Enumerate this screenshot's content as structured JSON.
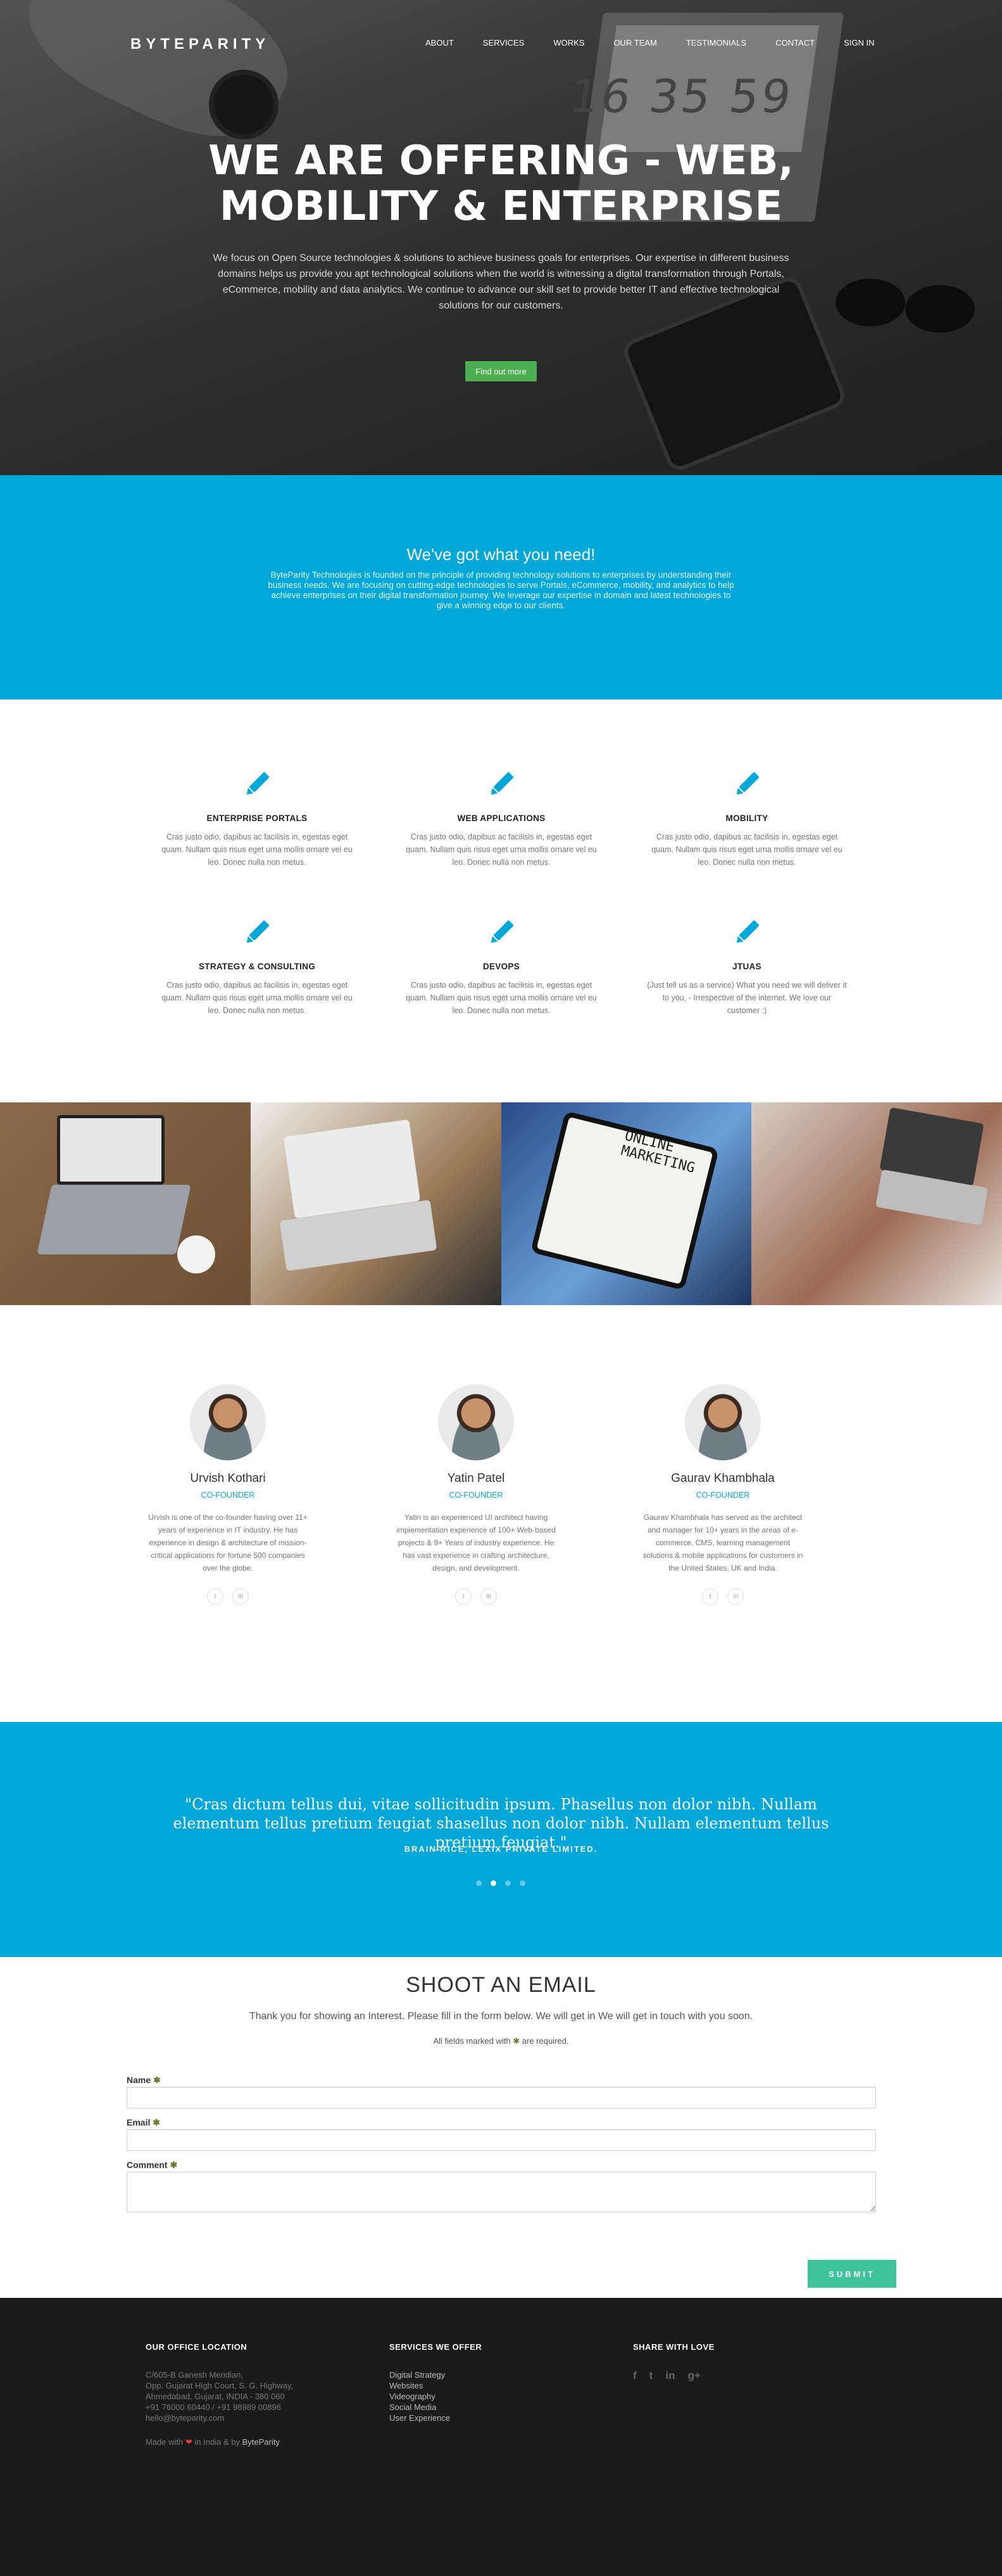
{
  "nav": {
    "logo": "BYTEPARITY",
    "links": [
      "ABOUT",
      "SERVICES",
      "WORKS",
      "OUR TEAM",
      "TESTIMONIALS",
      "CONTACT",
      "SIGN IN"
    ]
  },
  "hero": {
    "clock": "16 35 59",
    "title_line1": "WE ARE OFFERING - WEB,",
    "title_line2": "MOBILITY & ENTERPRISE",
    "text": "We focus on Open Source technologies & solutions to achieve business goals for enterprises. Our expertise in different business domains helps us provide you apt technological solutions when the world is witnessing a digital transformation through Portals, eCommerce, mobility and data analytics. We continue to advance our skill set to provide better IT and effective technological solutions for our customers.",
    "button": "Find out more"
  },
  "about": {
    "title": "We've got what you need!",
    "text": "ByteParity Technologies is founded on the principle of providing technology solutions to enterprises by understanding their business needs. We are focusing on cutting-edge technologies to serve Portals, eCommerce, mobility, and analytics to help achieve enterprises on their digital transformation journey. We leverage our expertise in domain and latest technologies to give a winning edge to our clients."
  },
  "services": [
    {
      "title": "ENTERPRISE PORTALS",
      "text": "Cras justo odio, dapibus ac facilisis in, egestas eget quam. Nullam quis risus eget urna mollis ornare vel eu leo. Donec nulla non metus.",
      "icon": "pencil-icon"
    },
    {
      "title": "WEB APPLICATIONS",
      "text": "Cras justo odio, dapibus ac facilisis in, egestas eget quam. Nullam quis risus eget urna mollis ornare vel eu leo. Donec nulla non metus.",
      "icon": "pencil-icon"
    },
    {
      "title": "MOBILITY",
      "text": "Cras justo odio, dapibus ac facilisis in, egestas eget quam. Nullam quis risus eget urna mollis ornare vel eu leo. Donec nulla non metus.",
      "icon": "pencil-icon"
    },
    {
      "title": "STRATEGY & CONSULTING",
      "text": "Cras justo odio, dapibus ac facilisis in, egestas eget quam. Nullam quis risus eget urna mollis ornare vel eu leo. Donec nulla non metus.",
      "icon": "pencil-icon"
    },
    {
      "title": "DEVOPS",
      "text": "Cras justo odio, dapibus ac facilisis in, egestas eget quam. Nullam quis risus eget urna mollis ornare vel eu leo. Donec nulla non metus.",
      "icon": "pencil-icon"
    },
    {
      "title": "JTUAS",
      "text": "(Just tell us as a service) What you need we will deliver it to you, - Irrespective of the internet. We love our customer :)",
      "icon": "pencil-icon"
    }
  ],
  "photos": {
    "marketing_sign": "ONLINE MARKETING"
  },
  "team": [
    {
      "name": "Urvish Kothari",
      "role": "CO-FOUNDER",
      "bio": "Urvish is one of the co-founder having over 11+ years of experience in IT industry. He has experience in design & architecture of mission-critical applications for fortune 500 companies over the globe."
    },
    {
      "name": "Yatin Patel",
      "role": "CO-FOUNDER",
      "bio": "Yatin is an experienced UI architect having implementation experience of 100+ Web-based projects & 9+ Years of industry experience. He has vast experience in crafting architecture, design, and development."
    },
    {
      "name": "Gaurav Khambhala",
      "role": "CO-FOUNDER",
      "bio": "Gaurav Khambhala has served as the architect and manager for 10+ years in the areas of e-commerce, CMS, learning management solutions & mobile applications for customers in the United States, UK and India."
    }
  ],
  "testimonial": {
    "quote": "\"Cras dictum tellus dui, vitae sollicitudin ipsum. Phasellus non dolor nibh. Nullam elementum tellus pretium feugiat shasellus non dolor nibh. Nullam elementum tellus pretium feugiat.\"",
    "author": "BRAIN RICE, LEXIX PRIVATE LIMITED.",
    "active_slide": 2,
    "slide_count": 4
  },
  "contact": {
    "title": "SHOOT AN EMAIL",
    "subtitle": "Thank you for showing an Interest. Please fill in the form below. We will get in We will get in touch with you soon.",
    "required_prefix": "All fields marked with",
    "required_suffix": "are required.",
    "required_star": "✱",
    "name_label": "Name",
    "email_label": "Email",
    "comment_label": "Comment",
    "submit": "SUBMIT"
  },
  "footer": {
    "office_title": "OUR OFFICE LOCATION",
    "address": [
      "C/605-B Ganesh Meridian,",
      "Opp. Gujarat High Court, S. G. Highway,",
      "Ahmedabad, Gujarat, INDIA - 380 060",
      "+91 76000 60440 / +91 98989 00896",
      "hello@byteparity.com"
    ],
    "made_prefix": "Made with",
    "made_middle": "in India & by",
    "made_brand": "ByteParity",
    "services_title": "SERVICES WE OFFER",
    "services": [
      "Digital Strategy",
      "Websites",
      "Videography",
      "Social Media",
      "User Experience"
    ],
    "share_title": "SHARE WITH LOVE",
    "share_icons": [
      "f",
      "t",
      "in",
      "g+"
    ]
  },
  "colors": {
    "brand_blue": "#00a8d9",
    "hero_button": "#4caf50",
    "submit_button": "#3ec39a",
    "footer_bg": "#1b1b1b"
  }
}
